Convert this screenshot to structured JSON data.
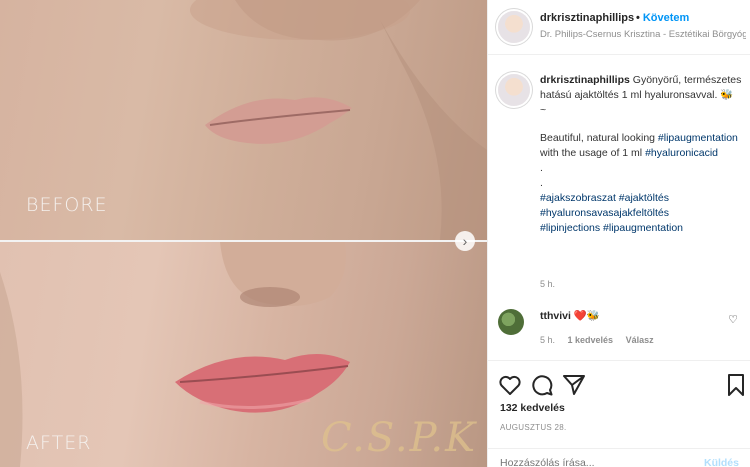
{
  "photo": {
    "before_label": "BEFORE",
    "after_label": "AFTER",
    "watermark": "C.S.P.K",
    "next_icon": "chevron-right-icon"
  },
  "header": {
    "username": "drkrisztinaphillips",
    "follow_dot": "•",
    "follow_label": "Követem",
    "subtitle": "Dr. Philips-Csernus Krisztina - Esztétikai Börgyógyászat"
  },
  "caption": {
    "username": "drkrisztinaphillips",
    "line1": "Gyönyörű, természetes hatású ajaktöltés 1 ml hyaluronsavval. 🐝",
    "tilde": "~",
    "en_text_1": "Beautiful, natural looking ",
    "en_hash_1": "#lipaugmentation",
    "en_text_2": " with the usage of 1 ml ",
    "en_hash_2": "#hyaluronicacid",
    "dot1": ".",
    "dot2": ".",
    "tags_1": "#ajakszobraszat #ajaktöltés",
    "tags_2": "#hyaluronsavasajakfeltöltés",
    "tags_3": "#lipinjections #lipaugmentation",
    "time": "5 h."
  },
  "comment": {
    "username": "tthvivi",
    "text": "❤️🐝",
    "time": "5 h.",
    "likes": "1 kedvelés",
    "reply": "Válasz"
  },
  "actions": {
    "likes": "132 kedvelés",
    "date": "AUGUSZTUS 28."
  },
  "add_comment": {
    "placeholder": "Hozzászólás írása...",
    "send": "Küldés"
  }
}
